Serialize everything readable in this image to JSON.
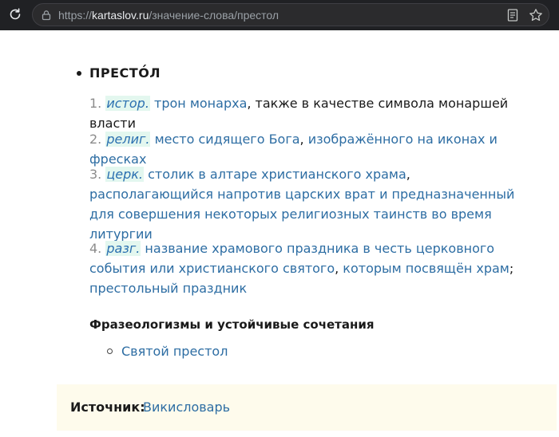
{
  "browser": {
    "url_protocol": "https://",
    "url_host": "kartaslov.ru",
    "url_path": "/значение-слова/престол",
    "icons": [
      "reload-icon",
      "site-info-icon",
      "reader-mode-icon",
      "favorite-star-icon"
    ]
  },
  "entry": {
    "headword": "ПРЕСТО́Л",
    "senses": [
      {
        "number": "1.",
        "tag": "истор.",
        "parts": [
          {
            "text": "трон монарха",
            "link": true
          },
          {
            "text": ", также в качестве символа монаршей власти",
            "link": false
          }
        ]
      },
      {
        "number": "2.",
        "tag": "религ.",
        "parts": [
          {
            "text": "место сидящего Бога",
            "link": true
          },
          {
            "text": ", ",
            "link": false
          },
          {
            "text": "изображённого на иконах и фресках",
            "link": true
          }
        ]
      },
      {
        "number": "3.",
        "tag": "церк.",
        "parts": [
          {
            "text": "столик в алтаре христианского храма",
            "link": true
          },
          {
            "text": ", ",
            "link": false
          },
          {
            "text": "располагающийся напротив царских врат и предназначенный для совершения некоторых религиозных таинств во время литургии",
            "link": true
          }
        ]
      },
      {
        "number": "4.",
        "tag": "разг.",
        "parts": [
          {
            "text": "название храмового праздника в честь церковного события или христианского святого",
            "link": true
          },
          {
            "text": ", ",
            "link": false
          },
          {
            "text": "которым посвящён храм",
            "link": true
          },
          {
            "text": "; ",
            "link": false
          },
          {
            "text": "престольный праздник",
            "link": true
          }
        ]
      }
    ]
  },
  "phraseology": {
    "heading": "Фразеологизмы и устойчивые сочетания",
    "items": [
      "Святой престол"
    ]
  },
  "source": {
    "label": "Источник:",
    "link_text": "Викисловарь"
  },
  "colors": {
    "link": "#2d6da3",
    "tag_background": "#e3f7ef",
    "source_background": "#fefbec",
    "browser_bar": "#202124"
  }
}
